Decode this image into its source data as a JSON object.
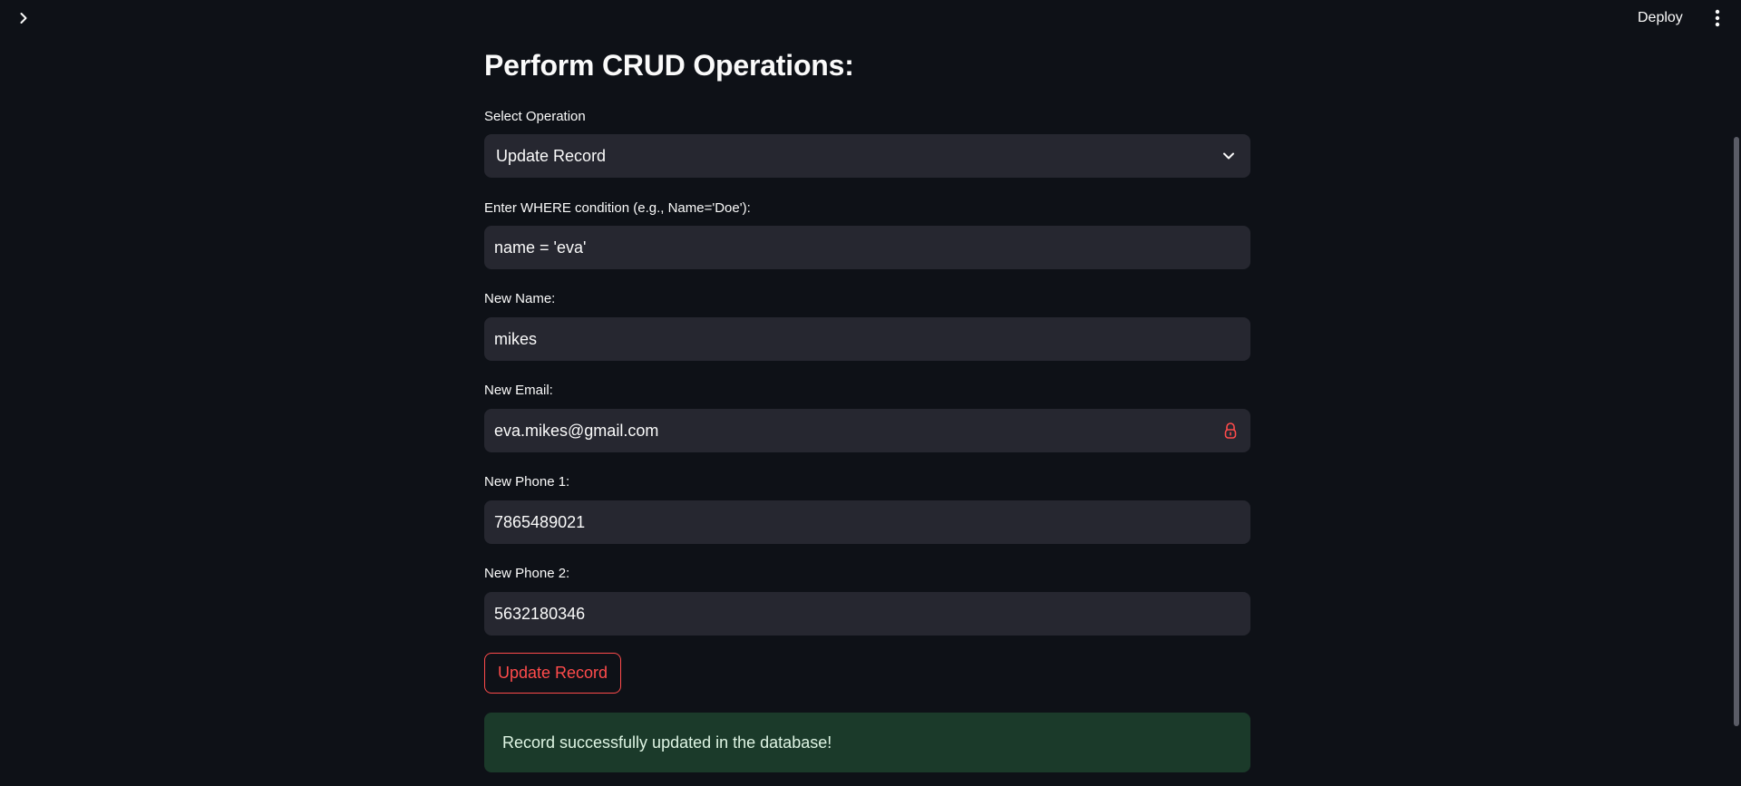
{
  "header": {
    "deploy_label": "Deploy",
    "sidebar_toggle_icon": "chevron-right-icon",
    "menu_icon": "vertical-ellipsis-icon"
  },
  "main": {
    "title": "Perform CRUD Operations:",
    "operation": {
      "label": "Select Operation",
      "selected": "Update Record"
    },
    "where": {
      "label": "Enter WHERE condition (e.g., Name='Doe'):",
      "value": "name = 'eva'"
    },
    "new_name": {
      "label": "New Name:",
      "value": "mikes"
    },
    "new_email": {
      "label": "New Email:",
      "value": "eva.mikes@gmail.com",
      "icon": "lock-icon"
    },
    "new_phone1": {
      "label": "New Phone 1:",
      "value": "7865489021"
    },
    "new_phone2": {
      "label": "New Phone 2:",
      "value": "5632180346"
    },
    "submit_label": "Update Record",
    "success_message": "Record successfully updated in the database!"
  },
  "colors": {
    "background": "#0e1117",
    "input_bg": "#262730",
    "accent": "#ff4b4b",
    "success_bg": "#1b3a2a"
  }
}
